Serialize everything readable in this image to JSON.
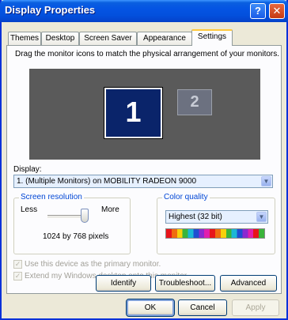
{
  "window": {
    "title": "Display Properties",
    "help_glyph": "?",
    "close_glyph": "✕"
  },
  "tabs": [
    {
      "label": "Themes"
    },
    {
      "label": "Desktop"
    },
    {
      "label": "Screen Saver"
    },
    {
      "label": "Appearance"
    },
    {
      "label": "Settings",
      "active": true
    }
  ],
  "settings": {
    "instruction": "Drag the monitor icons to match the physical arrangement of your monitors.",
    "monitors": [
      {
        "number": "1",
        "selected": true
      },
      {
        "number": "2",
        "selected": false
      }
    ],
    "display_label": "Display:",
    "display_value": "1. (Multiple Monitors) on MOBILITY RADEON 9000",
    "screen_resolution": {
      "title": "Screen resolution",
      "less": "Less",
      "more": "More",
      "value_text": "1024 by 768 pixels",
      "slider_level": 1.0
    },
    "color_quality": {
      "title": "Color quality",
      "value": "Highest (32 bit)",
      "strip_colors": [
        "#e8141a",
        "#f06c0e",
        "#f7d10b",
        "#3ab43a",
        "#1bb7d6",
        "#1f4fd1",
        "#8b2ad0",
        "#e11fae",
        "#e8141a",
        "#f06c0e",
        "#f7d10b",
        "#3ab43a",
        "#1bb7d6",
        "#1f4fd1",
        "#8b2ad0",
        "#e11fae",
        "#e8141a",
        "#3ab43a"
      ]
    },
    "checkboxes": {
      "primary": {
        "label": "Use this device as the primary monitor.",
        "checked": true,
        "enabled": false
      },
      "extend": {
        "label": "Extend my Windows desktop onto this monitor.",
        "checked": true,
        "enabled": false
      }
    },
    "buttons": {
      "identify": "Identify",
      "troubleshoot": "Troubleshoot...",
      "advanced": "Advanced"
    }
  },
  "dialog_buttons": {
    "ok": "OK",
    "cancel": "Cancel",
    "apply": "Apply"
  },
  "icons": {
    "combo_arrow": "chevron-down-icon",
    "check": "✓",
    "arrow_glyph": "▼"
  }
}
